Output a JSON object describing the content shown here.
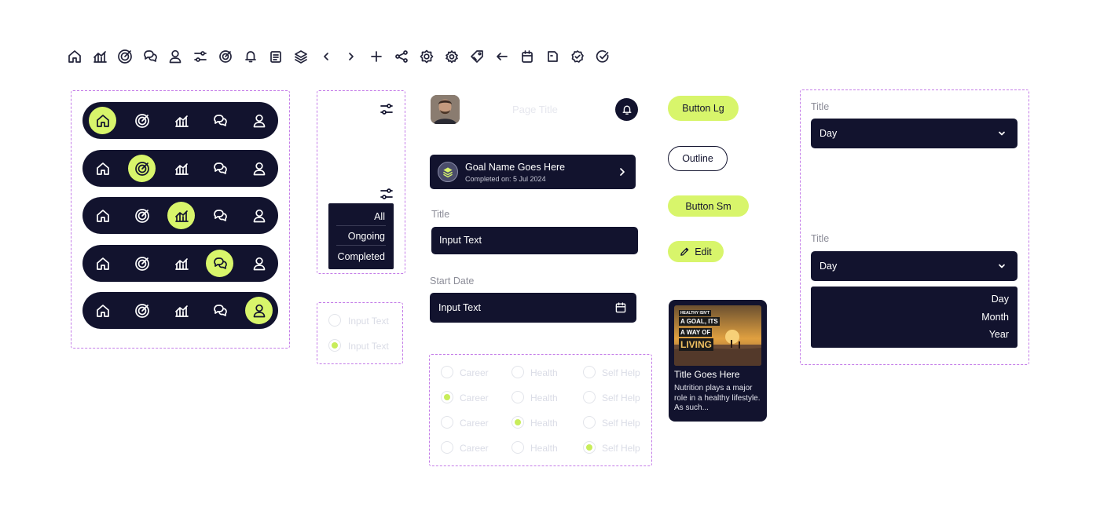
{
  "header": {
    "page_title": "Page Title"
  },
  "goal_card": {
    "name": "Goal Name Goes Here",
    "completed": "Completed on: 5 Jul 2024"
  },
  "form": {
    "title_label": "Title",
    "title_value": "Input Text",
    "start_label": "Start Date",
    "start_value": "Input Text"
  },
  "filter_menu": {
    "options": [
      "All",
      "Ongoing",
      "Completed"
    ]
  },
  "radio_small": {
    "options": [
      "Input Text",
      "Input Text"
    ]
  },
  "radio_grid": {
    "columns": [
      "Career",
      "Health",
      "Self Help"
    ]
  },
  "buttons": {
    "large": "Button Lg",
    "outline": "Outline",
    "small": "Button Sm",
    "edit": "Edit"
  },
  "article": {
    "image_text": [
      "HEALTHY ISN'T",
      "A GOAL, ITS",
      "A WAY OF",
      "LIVING"
    ],
    "title": "Title Goes Here",
    "excerpt": "Nutrition plays a major role in a healthy lifestyle. As such..."
  },
  "dropdowns": {
    "first_label": "Title",
    "first_value": "Day",
    "second_label": "Title",
    "second_value": "Day",
    "options": [
      "Day",
      "Month",
      "Year"
    ]
  },
  "icons": {
    "toolbar": [
      "home-icon",
      "chart-icon",
      "target-icon",
      "chat-icon",
      "user-icon",
      "sliders-icon",
      "target-small-icon",
      "bell-icon",
      "document-icon",
      "layers-icon",
      "chevron-left-icon",
      "chevron-right-icon",
      "plus-icon",
      "share-icon",
      "settings-icon",
      "gear-icon",
      "tag-icon",
      "arrow-left-icon",
      "calendar-icon",
      "file-icon",
      "badge-check-icon",
      "check-circle-icon"
    ]
  },
  "colors": {
    "navy": "#12132e",
    "lime": "#d8f56b",
    "dashed_border": "#c47ce8"
  }
}
